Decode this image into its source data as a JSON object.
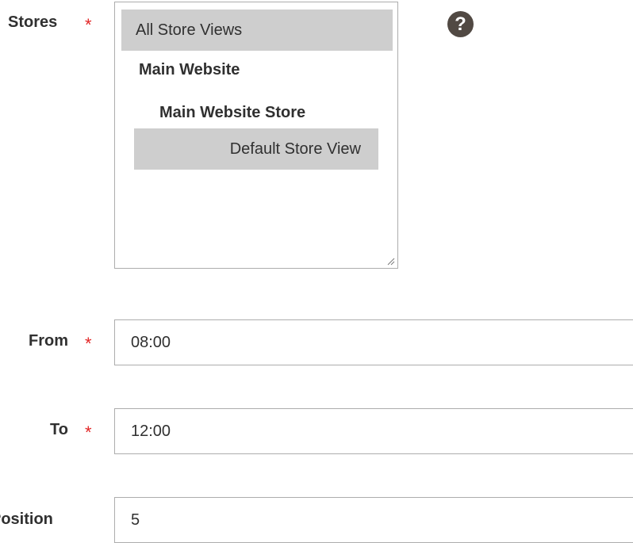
{
  "stores": {
    "label": "Stores",
    "required_mark": "*",
    "options": [
      {
        "label": "All Store Views",
        "selected": true
      },
      {
        "label": "Main Website",
        "selected": false
      },
      {
        "label": "Main Website Store",
        "selected": false
      },
      {
        "label": "Default Store View",
        "selected": true
      }
    ],
    "help_icon": "question-circle-icon"
  },
  "from": {
    "label": "From",
    "required_mark": "*",
    "value": "08:00"
  },
  "to": {
    "label": "To",
    "required_mark": "*",
    "value": "12:00"
  },
  "position": {
    "label": "Position",
    "value": "5"
  },
  "colors": {
    "required": "#e22626",
    "selected_bg": "#cecece",
    "help_bg": "#514943"
  }
}
